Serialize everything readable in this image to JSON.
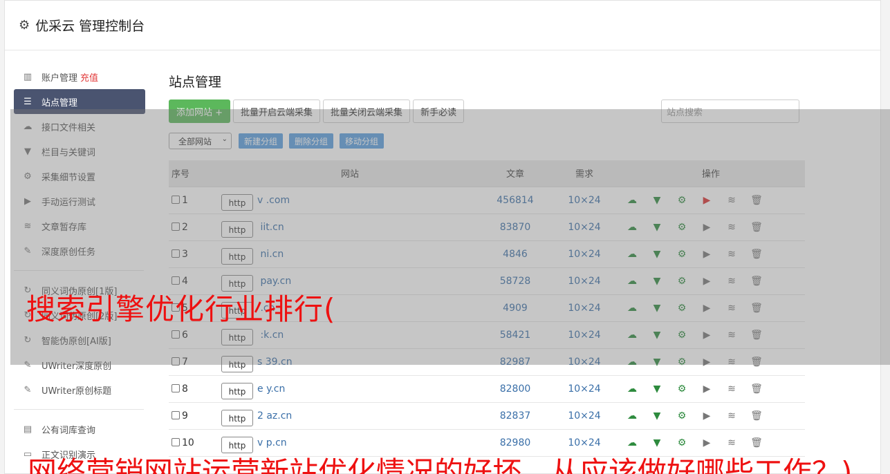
{
  "header": {
    "title": "优采云 管理控制台",
    "icon": "gear-icon"
  },
  "sidebar": {
    "items": [
      {
        "label": "账户管理",
        "extra": "充值",
        "icon": "bar-chart-icon",
        "active": false
      },
      {
        "label": "站点管理",
        "icon": "server-list-icon",
        "active": true
      },
      {
        "label": "接口文件相关",
        "icon": "cloud-upload-icon",
        "active": false
      },
      {
        "label": "栏目与关键词",
        "icon": "filter-icon",
        "active": false
      },
      {
        "label": "采集细节设置",
        "icon": "cogs-icon",
        "active": false
      },
      {
        "label": "手动运行测试",
        "icon": "play-circle-icon",
        "active": false
      },
      {
        "label": "文章暂存库",
        "icon": "database-icon",
        "active": false
      },
      {
        "label": "深度原创任务",
        "icon": "edit-icon",
        "active": false
      }
    ],
    "items2": [
      {
        "label": "同义词伪原创[1版]",
        "icon": "refresh-icon"
      },
      {
        "label": "同义词伪原创[2版]",
        "icon": "refresh-icon"
      },
      {
        "label": "智能伪原创[AI版]",
        "icon": "refresh-icon"
      },
      {
        "label": "UWriter深度原创",
        "icon": "edit-icon"
      },
      {
        "label": "UWriter原创标题",
        "icon": "edit-icon"
      }
    ],
    "items3": [
      {
        "label": "公有词库查询",
        "icon": "book-icon"
      },
      {
        "label": "正文识别演示",
        "icon": "monitor-icon"
      }
    ]
  },
  "main": {
    "title": "站点管理",
    "buttons": {
      "add_site": "添加网站 +",
      "batch_on": "批量开启云端采集",
      "batch_off": "批量关闭云端采集",
      "newbie": "新手必读"
    },
    "search_placeholder": "站点搜索",
    "group_select": "全部网站",
    "group_buttons": {
      "new": "新建分组",
      "delete": "删除分组",
      "move": "移动分组"
    },
    "table": {
      "headers": {
        "idx": "序号",
        "site": "网站",
        "articles": "文章",
        "demand": "需求",
        "ops": "操作"
      },
      "rows": [
        {
          "idx": "1",
          "proto": "http",
          "domain": "v          .com",
          "articles": "456814",
          "demand": "10×24",
          "running": true
        },
        {
          "idx": "2",
          "proto": "http",
          "domain": "      iit.cn",
          "articles": "83870",
          "demand": "10×24",
          "running": false
        },
        {
          "idx": "3",
          "proto": "http",
          "domain": "      ni.cn",
          "articles": "4846",
          "demand": "10×24",
          "running": false
        },
        {
          "idx": "4",
          "proto": "http",
          "domain": "       pay.cn",
          "articles": "58728",
          "demand": "10×24",
          "running": false
        },
        {
          "idx": "5",
          "proto": "http",
          "domain": "       .cn",
          "articles": "4909",
          "demand": "10×24",
          "running": false
        },
        {
          "idx": "6",
          "proto": "http",
          "domain": "      :k.cn",
          "articles": "58421",
          "demand": "10×24",
          "running": false
        },
        {
          "idx": "7",
          "proto": "http",
          "domain": "s   39.cn",
          "articles": "82987",
          "demand": "10×24",
          "running": false
        },
        {
          "idx": "8",
          "proto": "http",
          "domain": "e     y.cn",
          "articles": "82800",
          "demand": "10×24",
          "running": false
        },
        {
          "idx": "9",
          "proto": "http",
          "domain": "2     az.cn",
          "articles": "82837",
          "demand": "10×24",
          "running": false
        },
        {
          "idx": "10",
          "proto": "http",
          "domain": "v     p.cn",
          "articles": "82980",
          "demand": "10×24",
          "running": false
        }
      ]
    }
  },
  "overlay_text": {
    "line1": "搜索引擎优化行业排行(",
    "line2": "网络营销网站运营新站优化情况的好坏，从应该做好哪些工作？)"
  },
  "colors": {
    "accent_green": "#5cb85c",
    "sidebar_active": "#4a5470",
    "link_blue": "#3a6fa8",
    "overlay_red": "#ee1111"
  }
}
